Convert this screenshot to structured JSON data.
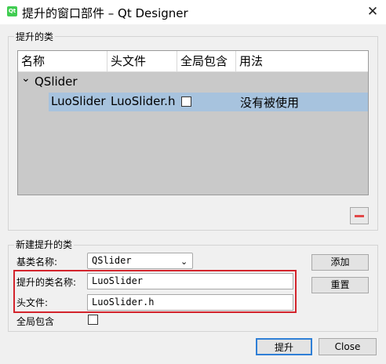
{
  "window": {
    "title": "提升的窗口部件 – Qt Designer",
    "app_icon_text": "Qt",
    "close_glyph": "✕"
  },
  "promoted_group": {
    "title": "提升的类",
    "columns": [
      "名称",
      "头文件",
      "全局包含",
      "用法"
    ],
    "tree": {
      "base_class": "QSlider",
      "expand_glyph": "⌄",
      "rows": [
        {
          "name": "LuoSlider",
          "header": "LuoSlider.h",
          "global_include": false,
          "usage": "没有被使用"
        }
      ]
    },
    "remove_button_icon": "minus-icon"
  },
  "new_group": {
    "title": "新建提升的类",
    "base_class_label": "基类名称:",
    "base_class_value": "QSlider",
    "class_name_label": "提升的类名称:",
    "class_name_value": "LuoSlider",
    "header_label": "头文件:",
    "header_value": "LuoSlider.h",
    "global_include_label": "全局包含",
    "global_include_checked": false,
    "add_label": "添加",
    "reset_label": "重置"
  },
  "footer": {
    "promote_label": "提升",
    "close_label": "Close"
  },
  "colors": {
    "selection": "#a7c3de",
    "highlight_border": "#d3242c",
    "remove_icon": "#e24848",
    "default_button_border": "#2f7fd6"
  }
}
